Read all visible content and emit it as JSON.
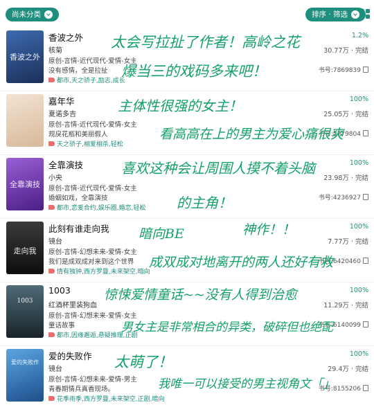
{
  "topbar": {
    "filter_label": "尚未分类",
    "sort_label": "排序 · 筛选",
    "grid_icon": "grid-view-icon"
  },
  "books": [
    {
      "title": "香波之外",
      "author": "核菊",
      "genre": "原创-言情-近代现代-爱情-女主",
      "desc": "没有感情，全是拉扯",
      "tags": "都市,天之骄子,励志,成长",
      "progress": "1.2%",
      "words": "30.77万 · 完结",
      "book_id": "书号:7869839",
      "cover_text": "香波之外",
      "cover_color": "#2e4f8a",
      "note": [
        "太会写拉扯了作者！高岭之花",
        "爆当三的戏码多来吧！"
      ]
    },
    {
      "title": "嘉年华",
      "author": "夏诺多吉",
      "genre": "原创-言情-近代现代-爱情-女主",
      "desc": "规戾花瓶和美丽假人",
      "tags": "天之骄子,相爱相杀,轻松",
      "progress": "100%",
      "words": "25.05万 · 完结",
      "book_id": "书号:5779804",
      "cover_text": "",
      "cover_color": "#e9d7c4",
      "note": [
        "主体性很强的女主！",
        "看高高在上的男主为爱心痛很爽"
      ]
    },
    {
      "title": "全靠演技",
      "author": "小央",
      "genre": "原创-言情-近代现代-爱情-女主",
      "desc": "婚姻如戏，全靠演技",
      "tags": "都市,恋爱合约,娱乐圈,婚恋,轻松",
      "progress": "100%",
      "words": "23.98万 · 完结",
      "book_id": "书号:4236927",
      "cover_text": "全靠演技",
      "cover_color": "#7a3fb3",
      "note": [
        "喜欢这种会让周围人摸不着头脑",
        "的主角！"
      ]
    },
    {
      "title": "此刻有谁走向我",
      "author": "镜台",
      "genre": "原创-言情-幻想未来-爱情-女主",
      "desc": "我们是成双成对来到这个世界",
      "tags": "情有独钟,西方罗曼,未来架空,暗向",
      "progress": "100%",
      "words": "7.77万 · 完结",
      "book_id": "书号:6420460",
      "cover_text": "走向我",
      "cover_color": "#1b1b1b",
      "note": [
        "暗向BE",
        "神作！！",
        "成双成对地离开的两人还好有救"
      ]
    },
    {
      "title": "1003",
      "author": "红酒杯里装狗血",
      "genre": "原创-言情-幻想未来-爱情-女主",
      "desc": "童话故事",
      "tags": "都市,因缘邂逅,悬疑推理,正剧",
      "progress": "100%",
      "words": "11.29万 · 完结",
      "book_id": "书号:6140099",
      "cover_text": "1003",
      "cover_color": "#2b3a44",
      "note": [
        "惊悚爱情童话~~没有人得到治愈",
        "男女主是非常相合的异类，破碎但也绝配"
      ]
    },
    {
      "title": "爱的失败作",
      "author": "镜台",
      "genre": "原创-言情-幻想未来-爱情-男主",
      "desc": "青春期情兵真香现场。",
      "tags": "花季雨季,西方罗曼,未来架空,正剧,暗向",
      "progress": "100%",
      "words": "29.4万 · 完结",
      "book_id": "书号:8155206",
      "cover_text": "爱的失败作",
      "cover_color": "#2a6fb0",
      "note": [
        "太萌了！",
        "我唯一可以接受的男主视角文「」"
      ]
    }
  ]
}
